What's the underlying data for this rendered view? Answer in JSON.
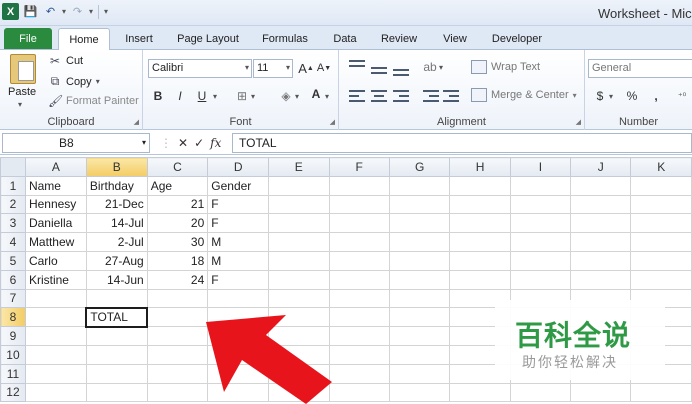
{
  "window": {
    "title": "Worksheet - Mic"
  },
  "qat": {
    "app_icon": "X"
  },
  "tabs": [
    {
      "label": "File"
    },
    {
      "label": "Home"
    },
    {
      "label": "Insert"
    },
    {
      "label": "Page Layout"
    },
    {
      "label": "Formulas"
    },
    {
      "label": "Data"
    },
    {
      "label": "Review"
    },
    {
      "label": "View"
    },
    {
      "label": "Developer"
    }
  ],
  "ribbon": {
    "clipboard": {
      "paste": "Paste",
      "cut": "Cut",
      "copy": "Copy",
      "format_painter": "Format Painter",
      "label": "Clipboard"
    },
    "font": {
      "name": "Calibri",
      "size": "11",
      "bold": "B",
      "italic": "I",
      "underline": "U",
      "grow": "A",
      "shrink": "A",
      "color": "A",
      "label": "Font",
      "font_color": "#e01010"
    },
    "alignment": {
      "wrap_text": "Wrap Text",
      "merge_center": "Merge & Center",
      "label": "Alignment"
    },
    "number": {
      "format": "General",
      "currency": "$",
      "percent": "%",
      "comma": ",",
      "label": "Number"
    }
  },
  "formula_bar": {
    "name_box": "B8",
    "cancel": "✕",
    "enter": "✓",
    "fx": "fx",
    "content": "TOTAL"
  },
  "grid": {
    "columns": [
      "A",
      "B",
      "C",
      "D",
      "E",
      "F",
      "G",
      "H",
      "I",
      "J",
      "K"
    ],
    "rows": [
      {
        "num": "1",
        "a": "Name",
        "b": "Birthday",
        "c": "Age",
        "d": "Gender"
      },
      {
        "num": "2",
        "a": "Hennesy",
        "b": "21-Dec",
        "c": "21",
        "d": "F"
      },
      {
        "num": "3",
        "a": "Daniella",
        "b": "14-Jul",
        "c": "20",
        "d": "F"
      },
      {
        "num": "4",
        "a": "Matthew",
        "b": "2-Jul",
        "c": "30",
        "d": "M"
      },
      {
        "num": "5",
        "a": "Carlo",
        "b": "27-Aug",
        "c": "18",
        "d": "M"
      },
      {
        "num": "6",
        "a": "Kristine",
        "b": "14-Jun",
        "c": "24",
        "d": "F"
      },
      {
        "num": "7",
        "a": "",
        "b": "",
        "c": "",
        "d": ""
      },
      {
        "num": "8",
        "a": "",
        "b": "TOTAL",
        "c": "",
        "d": ""
      },
      {
        "num": "9",
        "a": "",
        "b": "",
        "c": "",
        "d": ""
      },
      {
        "num": "10",
        "a": "",
        "b": "",
        "c": "",
        "d": ""
      },
      {
        "num": "11",
        "a": "",
        "b": "",
        "c": "",
        "d": ""
      },
      {
        "num": "12",
        "a": "",
        "b": "",
        "c": "",
        "d": ""
      }
    ]
  },
  "watermark": {
    "main": "百科全说",
    "sub": "助你轻松解决"
  },
  "colors": {
    "arrow": "#e8141b",
    "file_tab": "#2a8a3e",
    "watermark": "#2f9a46",
    "selected_header": "#f3cc63"
  }
}
